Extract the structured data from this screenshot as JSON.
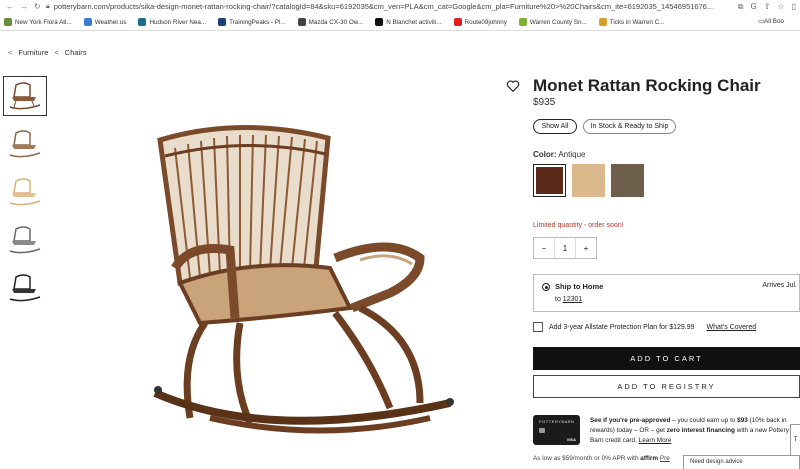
{
  "browser": {
    "url": "potterybarn.com/products/sika-design-monet-rattan-rocking-chair/?catalogId=84&sku=6192035&cm_ven=PLA&cm_cat=Google&cm_pla=Furniture%20>%20Chairs&cm_ite=6192035_14546951676..."
  },
  "bookmarks": [
    {
      "label": "New York Flora Atl...",
      "color": "#6a8f3c"
    },
    {
      "label": "Weather.us",
      "color": "#3a7bd5"
    },
    {
      "label": "Hudson River Nea...",
      "color": "#1f6b8a"
    },
    {
      "label": "TrainingPeaks - Pl...",
      "color": "#1d3d7a"
    },
    {
      "label": "Mazda CX-30 Ow...",
      "color": "#444444"
    },
    {
      "label": "N Blanchet activiti...",
      "color": "#111111"
    },
    {
      "label": "Route09johnny",
      "color": "#e02020"
    },
    {
      "label": "Warren County Sn...",
      "color": "#7fb032"
    },
    {
      "label": "Ticks in Warren C...",
      "color": "#d8a02a"
    }
  ],
  "bookmarks_all": "All Boo",
  "breadcrumb": {
    "items": [
      "Furniture",
      "Chairs"
    ]
  },
  "product": {
    "title": "Monet Rattan Rocking Chair",
    "price": "$935"
  },
  "filters": {
    "show_all": "Show All",
    "in_stock": "In Stock & Ready to Ship"
  },
  "color": {
    "label": "Color:",
    "selected": "Antique",
    "swatches": [
      "#5c2a1a",
      "#dcb98c",
      "#6e5f4c"
    ]
  },
  "limited": "Limited quantity - order soon!",
  "quantity": {
    "minus": "−",
    "value": "1",
    "plus": "+"
  },
  "shipping": {
    "title": "Ship to Home",
    "to_label": "to",
    "zip": "12301",
    "arrives": "Arrives Jul."
  },
  "protection": {
    "text": "Add 3-year Allstate Protection Plan for $129.99",
    "link": "What's Covered"
  },
  "buttons": {
    "cart": "ADD TO CART",
    "registry": "ADD TO REGISTRY"
  },
  "promo": {
    "card_brand": "POTTERYBARN",
    "card_network": "VISA",
    "lead": "See if you're pre-approved",
    "rest": " – you could earn up to ",
    "amount": "$93",
    "rest2": " (10% back in rewards)",
    "rest3": " today – OR – get ",
    "zero": "zero interest financing",
    "rest4": " with a new Pottery Barn credit card. ",
    "learn": "Learn More"
  },
  "affirm": {
    "text": "As low as $59/month or 0% APR with ",
    "brand": "affirm",
    "link": "Pre"
  },
  "popup": "Need design advice"
}
